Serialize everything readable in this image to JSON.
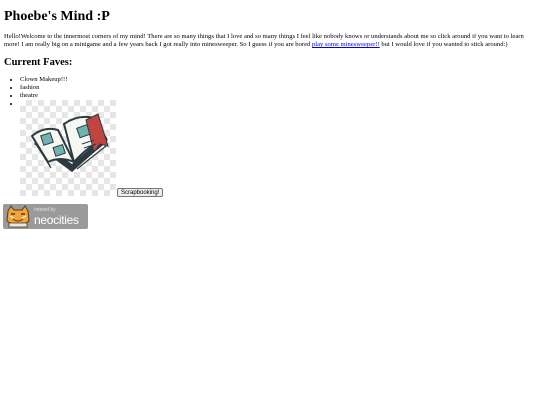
{
  "page": {
    "title": "Phoebe's Mind :P",
    "intro_before_link": "Hello!Welcome to the innermost corners of my mind! There are so many things that I love and so many things I feel like nobody knows or understands about me so click around if you want to learn more! I am really big on a minigame and a few years back I got really into minesweeper. So I guess if you are bored ",
    "intro_link": "play some minesweeper!!",
    "intro_after_link": " but I would love if you wanted to stick around:)"
  },
  "faves": {
    "heading": "Current Faves:",
    "items": [
      "Clown Makeup!!!",
      "fashion",
      "theatre"
    ],
    "image_icon": "open-book-icon",
    "button_label": "Scrapbooking!"
  },
  "badge": {
    "hosted_by": "hosted by",
    "name": "neocities",
    "icon": "neocities-cat-icon",
    "color": "#9a9a9a"
  },
  "colors": {
    "link": "#0000ee",
    "background": "#ffffff"
  }
}
